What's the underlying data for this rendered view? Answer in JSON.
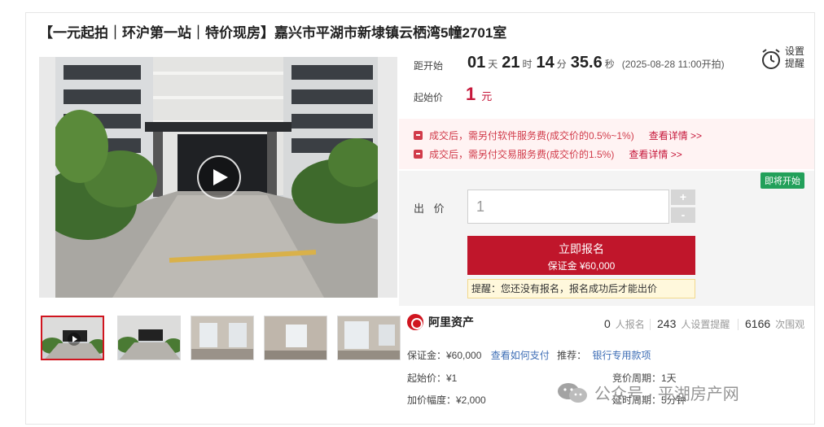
{
  "title": "【一元起拍｜环沪第一站｜特价现房】嘉兴市平湖市新埭镇云栖湾5幢2701室",
  "countdown": {
    "label": "距开始",
    "days": "01",
    "days_unit": "天",
    "hours": "21",
    "hours_unit": "时",
    "minutes": "14",
    "minutes_unit": "分",
    "seconds": "35.6",
    "seconds_unit": "秒",
    "start_time": "(2025-08-28 11:00开拍)"
  },
  "start_price": {
    "label": "起始价",
    "value": "1",
    "unit": "元"
  },
  "reminder": {
    "label": "设置提醒",
    "icon": "alarm-clock-icon"
  },
  "notices": [
    {
      "text": "成交后，需另付软件服务费(成交价的0.5%~1%)",
      "link": "查看详情 >>"
    },
    {
      "text": "成交后，需另付交易服务费(成交价的1.5%)",
      "link": "查看详情 >>"
    }
  ],
  "bid": {
    "status_badge": "即将开始",
    "label": "出 价",
    "input_value": "1",
    "plus": "+",
    "minus": "-",
    "signup_label": "立即报名",
    "deposit_label": "保证金 ¥60,000",
    "tip": "提醒：您还没有报名，报名成功后才能出价"
  },
  "platform": {
    "name": "阿里资产"
  },
  "stats": [
    {
      "value": "0",
      "label": "人报名"
    },
    {
      "value": "243",
      "label": "人设置提醒"
    },
    {
      "value": "6166",
      "label": "次围观"
    }
  ],
  "details": {
    "deposit_text": "保证金：¥60,000",
    "how_to_pay": "查看如何支付",
    "recommend_label": "推荐：",
    "recommend_link": "银行专用款项",
    "start_price_text": "起始价：¥1",
    "increment_text": "加价幅度：¥2,000",
    "bid_period_text": "竞价周期：1天",
    "delay_period_text": "延时周期：5分钟"
  },
  "watermark": {
    "text": "公众号 · 平湖房产网"
  },
  "colors": {
    "accent": "#c0162b",
    "green_badge": "#22a05a",
    "link_blue": "#3d6db5"
  }
}
